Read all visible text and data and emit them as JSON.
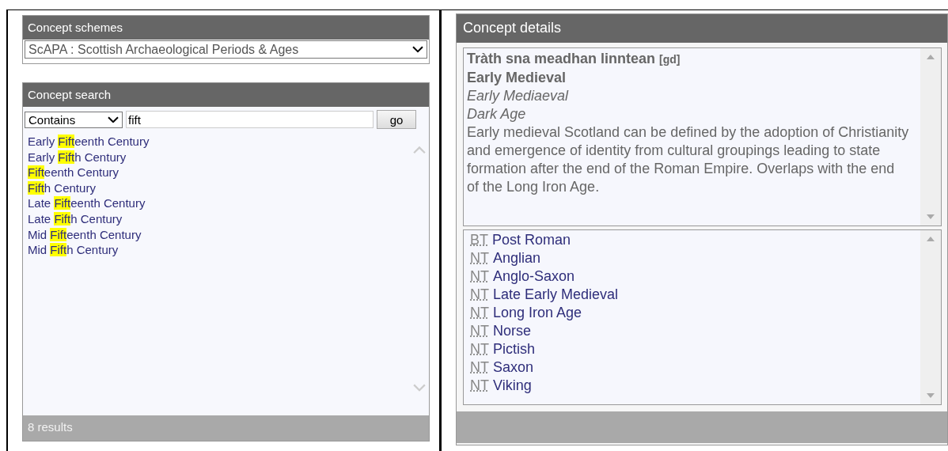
{
  "schemes": {
    "title": "Concept schemes",
    "selected": "ScAPA : Scottish Archaeological Periods & Ages"
  },
  "search": {
    "title": "Concept search",
    "mode": "Contains",
    "query": "fift",
    "button": "go",
    "results": [
      {
        "before": "Early ",
        "match": "Fift",
        "after": "eenth Century"
      },
      {
        "before": "Early ",
        "match": "Fift",
        "after": "h Century"
      },
      {
        "match": "Fift",
        "after": "eenth Century"
      },
      {
        "match": "Fift",
        "after": "h Century"
      },
      {
        "before": "Late ",
        "match": "Fift",
        "after": "eenth Century"
      },
      {
        "before": "Late ",
        "match": "Fift",
        "after": "h Century"
      },
      {
        "before": "Mid ",
        "match": "Fift",
        "after": "eenth Century"
      },
      {
        "before": "Mid ",
        "match": "Fift",
        "after": "h Century"
      }
    ],
    "status": "8 results"
  },
  "details": {
    "title": "Concept details",
    "label": "Tràth sna meadhan linntean",
    "language": "[gd]",
    "preferred": "Early Medieval",
    "alt_labels": [
      "Early Mediaeval",
      "Dark Age"
    ],
    "definition": "Early medieval Scotland can be defined by the adoption of Christianity and emergence of identity from cultural groupings leading to state formation after the end of the Roman Empire. Overlaps with the end of the Long Iron Age.",
    "relations": [
      {
        "type": "BT",
        "label": "Post Roman"
      },
      {
        "type": "NT",
        "label": "Anglian"
      },
      {
        "type": "NT",
        "label": "Anglo-Saxon"
      },
      {
        "type": "NT",
        "label": "Late Early Medieval"
      },
      {
        "type": "NT",
        "label": "Long Iron Age"
      },
      {
        "type": "NT",
        "label": "Norse"
      },
      {
        "type": "NT",
        "label": "Pictish"
      },
      {
        "type": "NT",
        "label": "Saxon"
      },
      {
        "type": "NT",
        "label": "Viking"
      }
    ]
  }
}
